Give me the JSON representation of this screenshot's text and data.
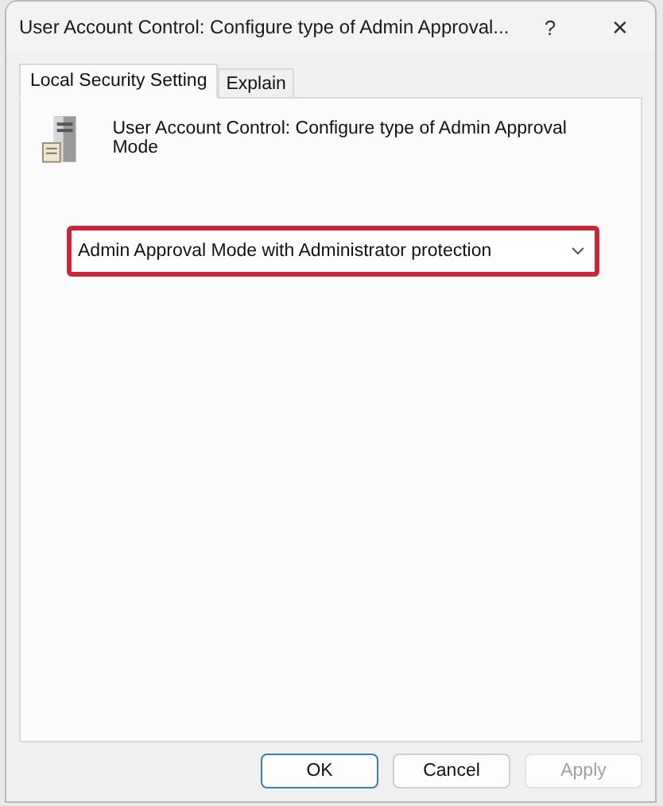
{
  "window": {
    "title": "User Account Control: Configure type of Admin Approval...",
    "help": "?",
    "close": "✕"
  },
  "tabs": [
    {
      "label": "Local Security Setting",
      "selected": true
    },
    {
      "label": "Explain",
      "selected": false
    }
  ],
  "policy": {
    "name": "User Account Control: Configure type of Admin Approval Mode"
  },
  "dropdown": {
    "value": "Admin Approval Mode with Administrator protection",
    "highlighted": true
  },
  "buttons": [
    {
      "label": "OK",
      "default": true,
      "disabled": false
    },
    {
      "label": "Cancel",
      "default": false,
      "disabled": false
    },
    {
      "label": "Apply",
      "default": false,
      "disabled": true
    }
  ]
}
